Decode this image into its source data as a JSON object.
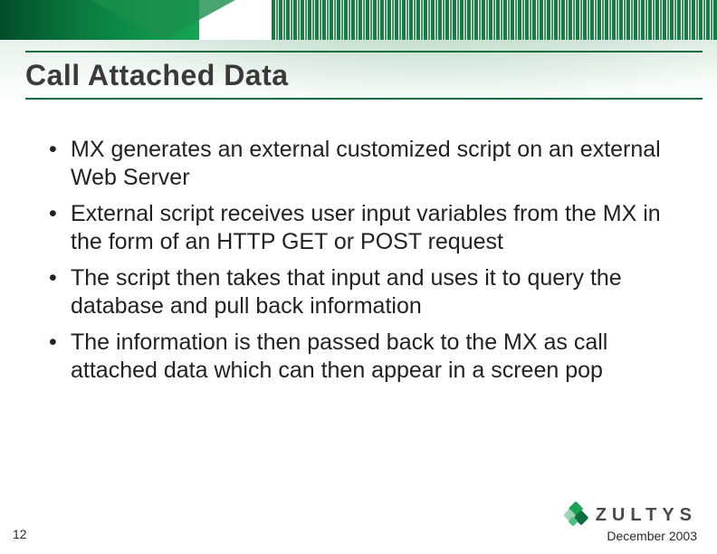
{
  "title": "Call Attached Data",
  "bullets": [
    "MX generates an external customized script on an external Web Server",
    "External script receives user input variables from the MX in the form of an HTTP GET or POST request",
    "The script then takes that input and uses it to query the database and pull back information",
    " The information is then passed back to the MX as call attached data which can then appear in a screen pop"
  ],
  "footer": {
    "page_number": "12",
    "brand": "ZULTYS",
    "date": "December 2003"
  },
  "colors": {
    "accent_green_dark": "#0f6e3d",
    "accent_green": "#18a654",
    "text": "#222222",
    "title_text": "#3a3a3a"
  }
}
